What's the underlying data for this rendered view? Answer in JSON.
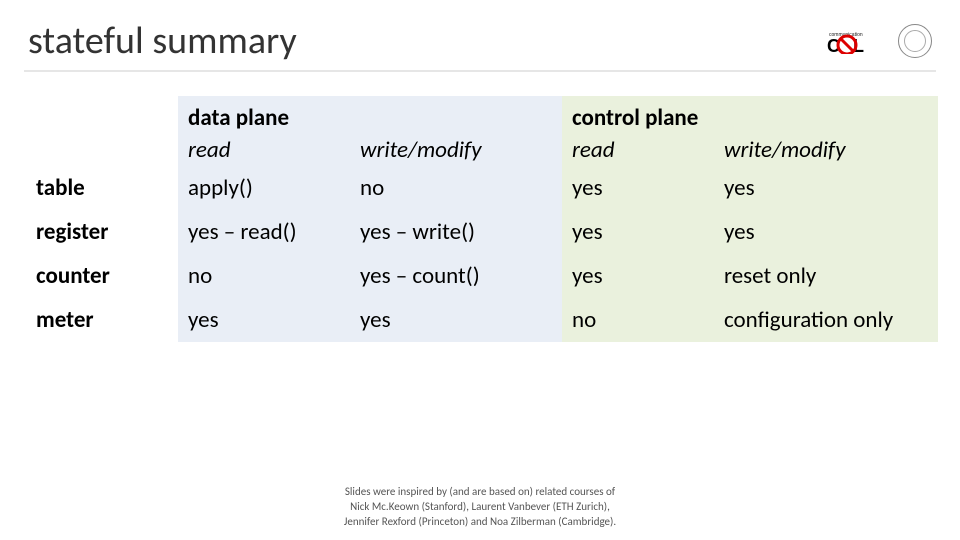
{
  "title": "stateful summary",
  "logos": {
    "cnl": "CNL logo",
    "seal": "university seal"
  },
  "table": {
    "group_headers": {
      "data_plane": "data plane",
      "control_plane": "control plane"
    },
    "sub_headers": {
      "dp_read": "read",
      "dp_write": "write/modify",
      "cp_read": "read",
      "cp_write": "write/modify"
    },
    "rows": [
      {
        "label": "table",
        "dp_read": "apply()",
        "dp_write": "no",
        "cp_read": "yes",
        "cp_write": "yes"
      },
      {
        "label": "register",
        "dp_read": "yes – read()",
        "dp_write": "yes – write()",
        "cp_read": "yes",
        "cp_write": "yes"
      },
      {
        "label": "counter",
        "dp_read": "no",
        "dp_write": "yes – count()",
        "cp_read": "yes",
        "cp_write": "reset only"
      },
      {
        "label": "meter",
        "dp_read": "yes",
        "dp_write": "yes",
        "cp_read": "no",
        "cp_write": "configuration only"
      }
    ]
  },
  "footer": {
    "line1": "Slides were inspired by (and are based on) related courses of",
    "line2": "Nick Mc.Keown (Stanford), Laurent Vanbever (ETH Zurich),",
    "line3": "Jennifer Rexford (Princeton) and Noa Zilberman (Cambridge)."
  }
}
